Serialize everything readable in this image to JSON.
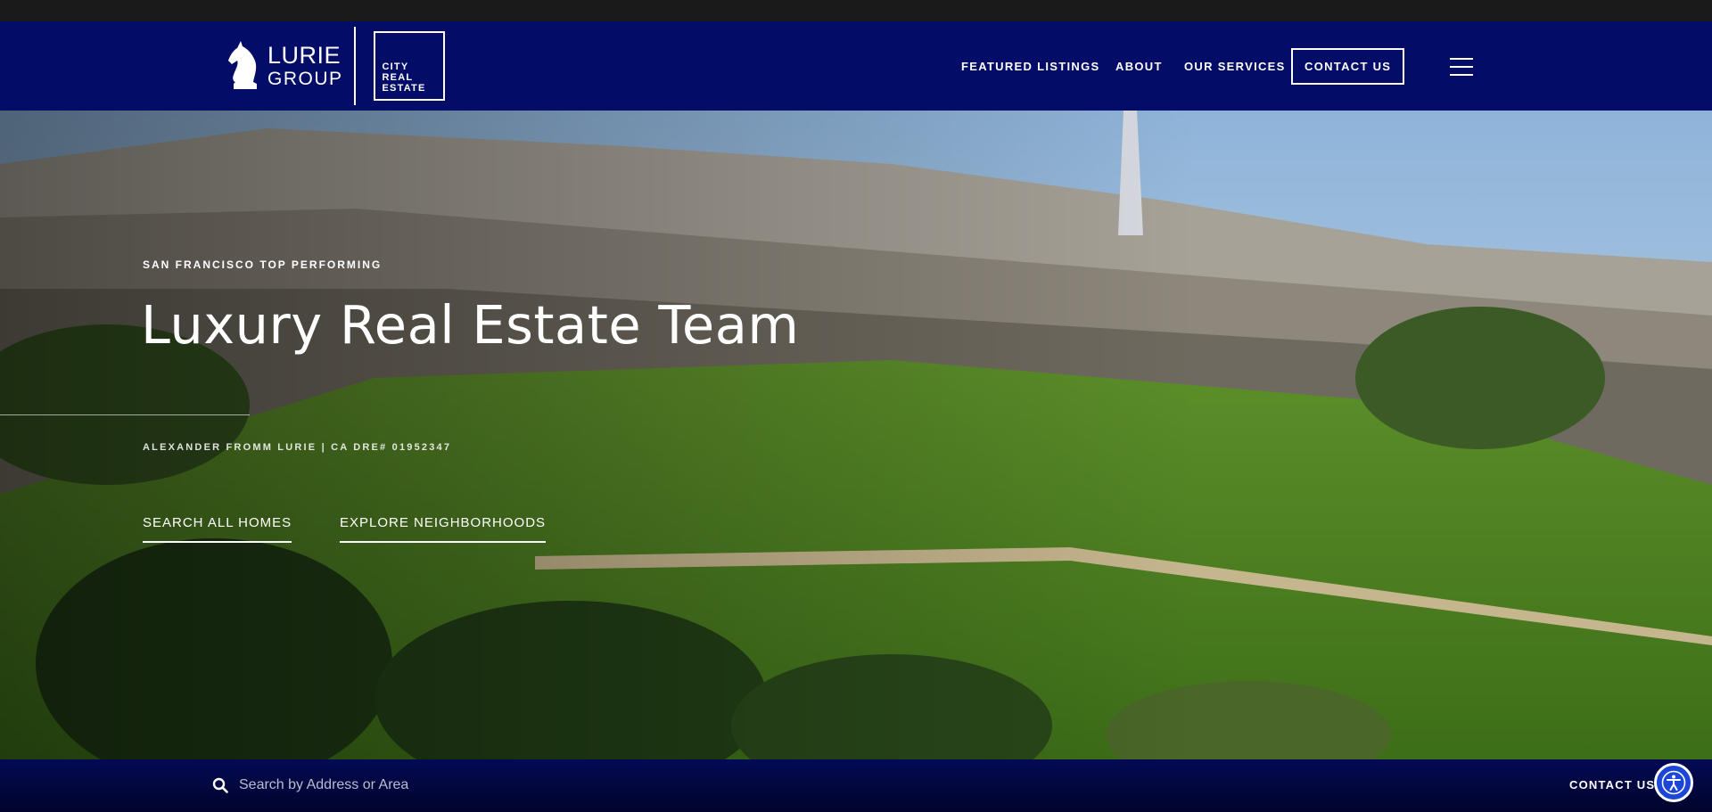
{
  "logo": {
    "primary": "LURIE",
    "secondary": "GROUP",
    "badge_lines": [
      "CITY",
      "REAL",
      "ESTATE"
    ]
  },
  "nav": {
    "featured": "FEATURED LISTINGS",
    "about": "ABOUT",
    "services": "OUR SERVICES",
    "contact": "CONTACT US",
    "menu_icon": "hamburger-menu-icon"
  },
  "hero": {
    "eyebrow": "SAN FRANCISCO TOP PERFORMING",
    "title": "Luxury Real Estate Team",
    "agent": "ALEXANDER FROMM LURIE | CA DRE# 01952347",
    "cta_primary": "SEARCH ALL HOMES",
    "cta_secondary": "EXPLORE NEIGHBORHOODS"
  },
  "bottom_bar": {
    "search_placeholder": "Search by Address or Area",
    "search_icon": "search-icon",
    "contact": "CONTACT US",
    "accessibility_icon": "accessibility-icon"
  },
  "colors": {
    "brand_navy": "#030c67",
    "accessibility_blue": "#1b46d6"
  }
}
